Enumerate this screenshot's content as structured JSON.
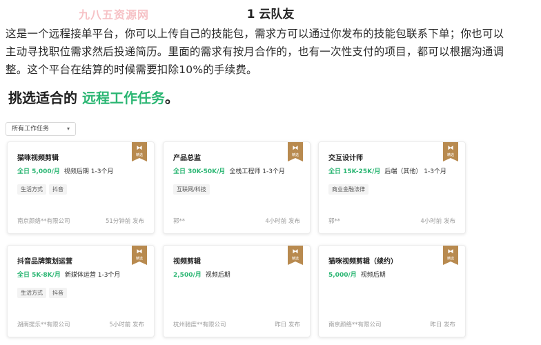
{
  "heading": "1 云队友",
  "watermark": "九八五资源网",
  "intro": {
    "line1": "这是一个远程接单平台，你可以上传自己的技能包，需求方可以通过你发布的技能包联系下单；你也可以",
    "line2": "主动寻找职位需求然后投递简历。里面的需求有按月合作的，也有一次性支付的项目，都可以根据沟通调",
    "line3": "整。这个平台在结算的时候需要扣除10%的手续费。"
  },
  "subhead": {
    "prefix": "挑选适合的 ",
    "highlight": "远程工作任务",
    "suffix": "。"
  },
  "filter": {
    "selected": "所有工作任务",
    "caret": "▾"
  },
  "badge": {
    "text": "精选"
  },
  "cards": [
    {
      "title": "猫咪视频剪辑",
      "salary": "全日 5,000/月",
      "extra": "视频后期 1-3个月",
      "tags": [
        "生活方式",
        "抖音"
      ],
      "company": "南京颜络**有限公司",
      "time": "51分钟前 发布"
    },
    {
      "title": "产品总监",
      "salary": "全日 30K-50K/月",
      "extra": "全栈工程师 1-3个月",
      "tags": [
        "互联网/科技"
      ],
      "company": "郭**",
      "time": "4小时前 发布"
    },
    {
      "title": "交互设计师",
      "salary": "全日 15K-25K/月",
      "extra": "后端（其他） 1-3个月",
      "tags": [
        "商业金融法律"
      ],
      "company": "郭**",
      "time": "4小时前 发布"
    },
    {
      "title": "抖音品牌策划运营",
      "salary": "全日 5K-8K/月",
      "extra": "新媒体运营 1-3个月",
      "tags": [
        "生活方式",
        "抖音"
      ],
      "company": "湖南提乐**有限公司",
      "time": "5小时前 发布"
    },
    {
      "title": "视频剪辑",
      "salary": "2,500/月",
      "extra": "视频后期",
      "tags": [],
      "company": "杭州驰度**有限公司",
      "time": "昨日 发布"
    },
    {
      "title": "猫咪视频剪辑（续约）",
      "salary": "5,000/月",
      "extra": "视频后期",
      "tags": [],
      "company": "南京颜络**有限公司",
      "time": "昨日 发布"
    }
  ]
}
